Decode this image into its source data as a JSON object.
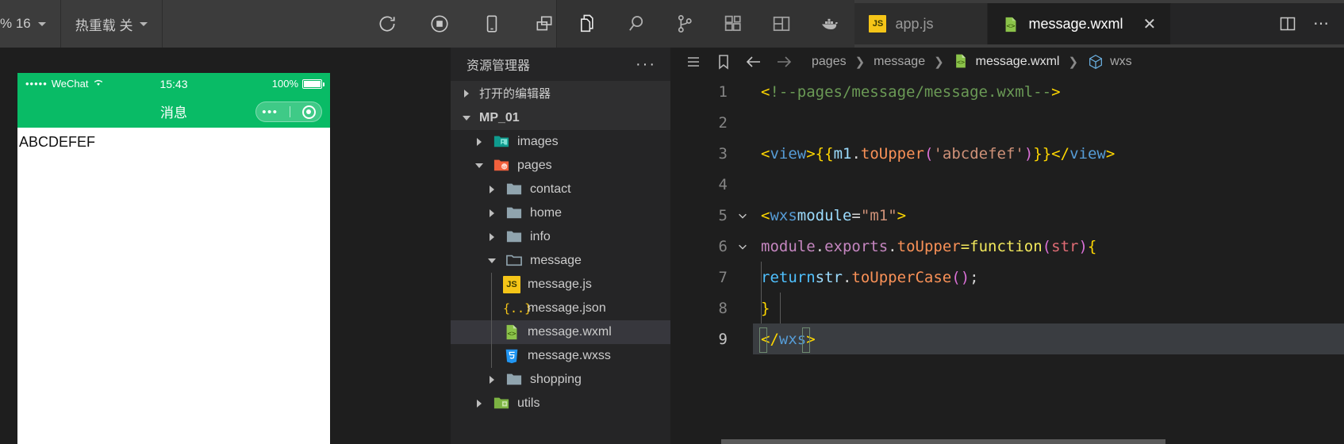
{
  "toolbar": {
    "zoom_label": "% 16",
    "hotreload_label": "热重载 关",
    "icons": [
      {
        "name": "refresh-icon"
      },
      {
        "name": "stop-record-icon"
      },
      {
        "name": "mobile-preview-icon"
      },
      {
        "name": "multi-window-icon"
      }
    ]
  },
  "activity_bar": {
    "items": [
      {
        "name": "explorer-icon",
        "label": "Explorer"
      },
      {
        "name": "search-icon",
        "label": "Search"
      },
      {
        "name": "source-control-icon",
        "label": "Source Control"
      },
      {
        "name": "extensions-icon",
        "label": "Extensions"
      },
      {
        "name": "layout-icon",
        "label": "Layout"
      },
      {
        "name": "docker-icon",
        "label": "Docker"
      }
    ]
  },
  "tabs": [
    {
      "label": "app.js",
      "icon": "js-file-icon",
      "active": false,
      "closable": false
    },
    {
      "label": "message.wxml",
      "icon": "wxml-file-icon",
      "active": true,
      "closable": true,
      "close_glyph": "✕"
    }
  ],
  "editor_actions": {
    "split_editor_label": "Split Editor",
    "more_actions_glyph": "⋯"
  },
  "simulator": {
    "status_bar": {
      "carrier": "WeChat",
      "signal_dots": "•••••",
      "time": "15:43",
      "battery_text": "100%"
    },
    "nav_title": "消息",
    "capsule": {
      "dots": "•••"
    },
    "page_text": "ABCDEFEF",
    "brand_color": "#09bb66"
  },
  "explorer": {
    "title": "资源管理器",
    "more_glyph": "···",
    "sections": [
      {
        "label": "打开的编辑器",
        "expanded": false
      },
      {
        "label": "MP_01",
        "expanded": true
      }
    ],
    "tree": [
      {
        "label": "images",
        "type": "folder",
        "icon": "images-folder-icon",
        "depth": 1,
        "expanded": false,
        "selected": false
      },
      {
        "label": "pages",
        "type": "folder",
        "icon": "pages-folder-icon",
        "depth": 1,
        "expanded": true,
        "selected": false
      },
      {
        "label": "contact",
        "type": "folder",
        "icon": "folder-icon",
        "depth": 2,
        "expanded": false,
        "selected": false
      },
      {
        "label": "home",
        "type": "folder",
        "icon": "folder-icon",
        "depth": 2,
        "expanded": false,
        "selected": false
      },
      {
        "label": "info",
        "type": "folder",
        "icon": "folder-icon",
        "depth": 2,
        "expanded": false,
        "selected": false
      },
      {
        "label": "message",
        "type": "folder",
        "icon": "folder-open-icon",
        "depth": 2,
        "expanded": true,
        "selected": false
      },
      {
        "label": "message.js",
        "type": "file",
        "icon": "js-file-icon",
        "depth": 3,
        "selected": false
      },
      {
        "label": "message.json",
        "type": "file",
        "icon": "json-file-icon",
        "depth": 3,
        "selected": false
      },
      {
        "label": "message.wxml",
        "type": "file",
        "icon": "wxml-file-icon",
        "depth": 3,
        "selected": true
      },
      {
        "label": "message.wxss",
        "type": "file",
        "icon": "wxss-file-icon",
        "depth": 3,
        "selected": false
      },
      {
        "label": "shopping",
        "type": "folder",
        "icon": "folder-icon",
        "depth": 2,
        "expanded": false,
        "selected": false
      },
      {
        "label": "utils",
        "type": "folder",
        "icon": "utils-folder-icon",
        "depth": 1,
        "expanded": false,
        "selected": false
      }
    ]
  },
  "breadcrumb": {
    "icons": [
      {
        "name": "outline-list-icon"
      },
      {
        "name": "bookmark-icon"
      },
      {
        "name": "navigate-back-icon"
      },
      {
        "name": "navigate-forward-icon"
      }
    ],
    "items": [
      {
        "label": "pages",
        "icon": null
      },
      {
        "label": "message",
        "icon": null
      },
      {
        "label": "message.wxml",
        "icon": "wxml-file-icon"
      },
      {
        "label": "wxs",
        "icon": "module-cube-icon"
      }
    ],
    "separator": "❯"
  },
  "code": {
    "language": "wxml",
    "line_numbers": [
      1,
      2,
      3,
      4,
      5,
      6,
      7,
      8,
      9
    ],
    "folds": {
      "5": "chevron-down-icon",
      "6": "chevron-down-icon"
    },
    "highlighted_line": 9,
    "lines": [
      {
        "n": 1,
        "text": "<!--pages/message/message.wxml-->"
      },
      {
        "n": 2,
        "text": ""
      },
      {
        "n": 3,
        "text": "<view>{{m1.toUpper('abcdefef')}}</view>"
      },
      {
        "n": 4,
        "text": ""
      },
      {
        "n": 5,
        "text": "<wxs module=\"m1\">"
      },
      {
        "n": 6,
        "text": "  module.exports.toUpper = function (str) {"
      },
      {
        "n": 7,
        "text": "    return str.toUpperCase();"
      },
      {
        "n": 8,
        "text": "  }"
      },
      {
        "n": 9,
        "text": "</wxs>"
      }
    ]
  },
  "colors": {
    "accent_green": "#09bb66",
    "editor_bg": "#1e1e1e",
    "sidebar_bg": "#252526",
    "toolbar_bg": "#3c3c3c",
    "selection_bg": "#37373d"
  }
}
